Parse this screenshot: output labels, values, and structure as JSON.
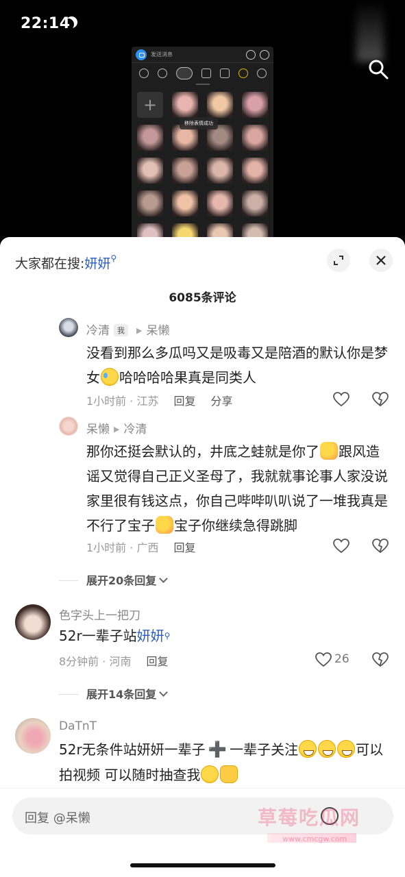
{
  "status_bar": {
    "time": "22:14",
    "focus_icon": "moon-icon"
  },
  "video": {
    "send_label": "发送消息",
    "toast": "移除表情成功",
    "plus": "+",
    "thumb_colors": [
      "#e9b4b0",
      "#f1c8a4",
      "#d8a0a8",
      "#c49898",
      "#e7b6a4",
      "#a38a82",
      "#d9a7a0",
      "#e3c0b4",
      "#c9a196",
      "#dcb6aa",
      "#e4b3a8",
      "#b89a8e",
      "#f0c2a6",
      "#e5b7ad",
      "#ccb0a8",
      "#e0c0c0",
      "#f5d770",
      "#e8c8b0",
      "#d4bcb0"
    ]
  },
  "sheet": {
    "search_prefix": "大家都在搜:",
    "search_keyword": "妍妍",
    "comment_count_title": "6085条评论",
    "comments": [
      {
        "user": "冷清",
        "tag": "我",
        "reply_to": "呆懒",
        "text_before": "没看到那么多瓜吗又是吸毒又是陪酒的默认你是梦女",
        "text_after": "哈哈哈哈果真是同类人",
        "time_location": "1小时前 · 江苏",
        "reply_label": "回复",
        "share_label": "分享"
      },
      {
        "user": "呆懒",
        "reply_to": "冷清",
        "text_a": "那你还挺会默认的，井底之蛙就是你了",
        "text_b": "跟风造谣又觉得自己正义圣母了，我就就事论事人家没说家里很有钱这点，你自己哔哔叭叭说了一堆我真是不行了宝子",
        "text_c": "宝子你继续急得跳脚",
        "time_location": "1小时前 · 广西",
        "reply_label": "回复"
      },
      {
        "expand_label": "展开20条回复"
      },
      {
        "user": "色字头上一把刀",
        "text": "52r一辈子站",
        "keyword": "妍妍",
        "time_location": "8分钟前 · 河南",
        "reply_label": "回复",
        "likes": "26"
      },
      {
        "expand_label": "展开14条回复"
      },
      {
        "user": "DaTnT",
        "text_a": "52r无条件站妍妍一辈子",
        "text_b": "一辈子关注",
        "text_c": "可以拍视频 可以随时抽查我"
      }
    ],
    "reply_placeholder": "回复 @呆懒"
  },
  "watermark": {
    "name": "草莓吃瓜网",
    "url": "www.cmcgw.com"
  },
  "colors": {
    "accent": "#2b5cbf",
    "sheet_bg": "#ffffff",
    "page_bg": "#000000"
  }
}
